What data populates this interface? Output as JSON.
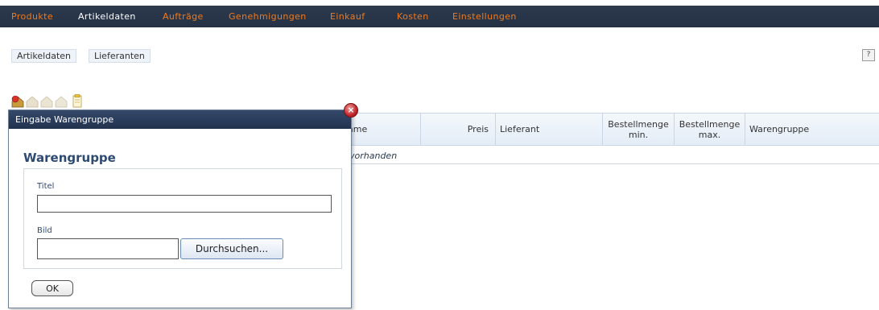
{
  "nav": {
    "items": [
      "Produkte",
      "Artikeldaten",
      "Aufträge",
      "Genehmigungen",
      "Einkauf",
      "Kosten",
      "Einstellungen"
    ],
    "active": "Artikeldaten",
    "colors": {
      "bar": "#243044",
      "item": "#f07a1a",
      "active": "#ffffff"
    }
  },
  "subtabs": [
    "Artikeldaten",
    "Lieferanten"
  ],
  "help": {
    "label": "?"
  },
  "toolbar": {
    "icons": [
      "add-icon",
      "edit-icon",
      "delete-icon",
      "copy-icon",
      "document-icon"
    ]
  },
  "table": {
    "columns": [
      "ame",
      "Preis",
      "Lieferant",
      "Bestellmenge min.",
      "Bestellmenge max.",
      "Warengruppe"
    ],
    "empty_text": "vorhanden"
  },
  "dialog": {
    "title": "Eingabe Warengruppe",
    "heading": "Warengruppe",
    "fields": {
      "title_label": "Titel",
      "title_value": "",
      "image_label": "Bild",
      "image_value": "",
      "browse_label": "Durchsuchen..."
    },
    "ok_label": "OK",
    "close_label": "×"
  }
}
